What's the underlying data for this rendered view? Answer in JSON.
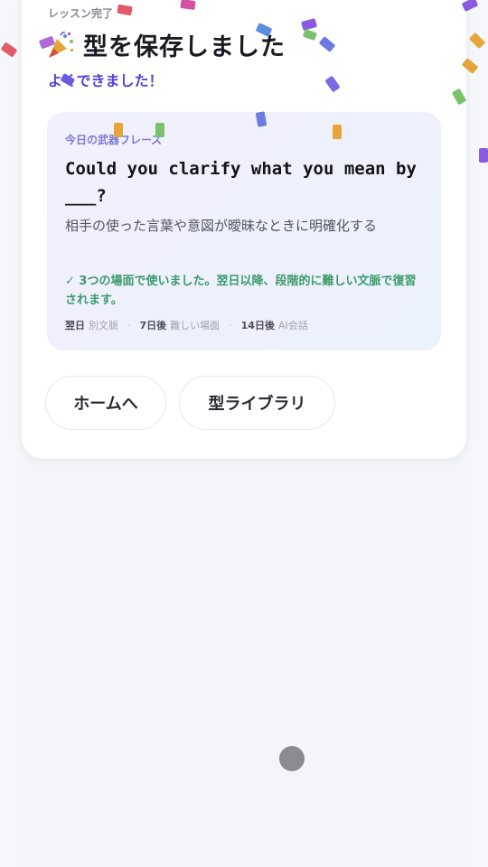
{
  "header": {
    "eyebrow": "レッスン完了",
    "title": "型を保存しました",
    "title_icon": "party-popper-icon",
    "subtitle": "よくできました！"
  },
  "phrase_card": {
    "label": "今日の武器フレーズ",
    "phrase": "Could you clarify what you mean by ___?",
    "meaning": "相手の使った言葉や意図が曖昧なときに明確化する",
    "note": "✓ 3つの場面で使いました。翌日以降、段階的に難しい文脈で復習されます。",
    "schedule": [
      {
        "day": "翌日",
        "desc": "別文脈"
      },
      {
        "day": "7日後",
        "desc": "難しい場面"
      },
      {
        "day": "14日後",
        "desc": "AI会話"
      }
    ]
  },
  "actions": {
    "home_label": "ホームへ",
    "library_label": "型ライブラリ"
  },
  "colors": {
    "accent": "#5b3fd8",
    "success": "#3a9a6a",
    "phrase_label": "#7d79d6"
  }
}
